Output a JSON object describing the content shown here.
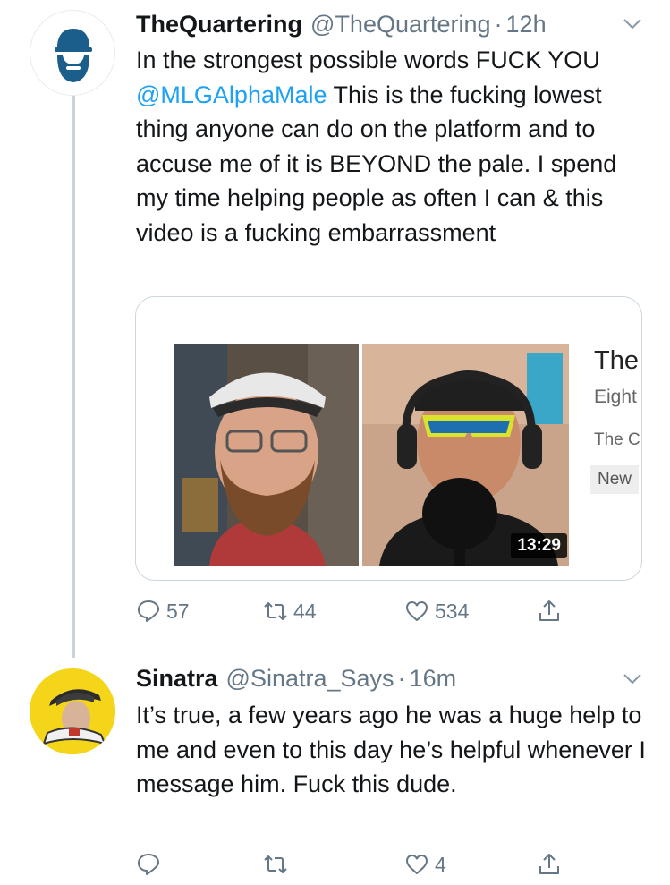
{
  "tweet1": {
    "display_name": "TheQuartering",
    "handle": "@TheQuartering",
    "separator": "·",
    "time": "12h",
    "text_before": "In the strongest possible words FUCK YOU ",
    "mention": "@MLGAlphaMale",
    "text_after": " This is the fucking lowest thing anyone can do on the platform and to accuse me of it is BEYOND the pale.  I spend my time helping people as often I can & this video is a fucking embarrassment",
    "card": {
      "duration": "13:29",
      "title": "The",
      "line1": "Eight",
      "line2": "The C",
      "badge": "New"
    },
    "replies": "57",
    "retweets": "44",
    "likes": "534"
  },
  "tweet2": {
    "display_name": "Sinatra",
    "handle": "@Sinatra_Says",
    "separator": "·",
    "time": "16m",
    "text": "It’s true, a few years ago he was a huge help to me and even to this day he’s helpful whenever I message him. Fuck this dude.",
    "replies": "",
    "retweets": "",
    "likes": "4"
  },
  "colors": {
    "link": "#1da1f2",
    "secondary": "#657786",
    "border": "#ccd6dd",
    "thread_line": "#cbd3da",
    "avatar2_bg": "#f5d51a",
    "avatar1_icon": "#1b5e8c"
  },
  "icons": [
    "reply-icon",
    "retweet-icon",
    "like-icon",
    "share-icon",
    "chevron-down-icon"
  ]
}
